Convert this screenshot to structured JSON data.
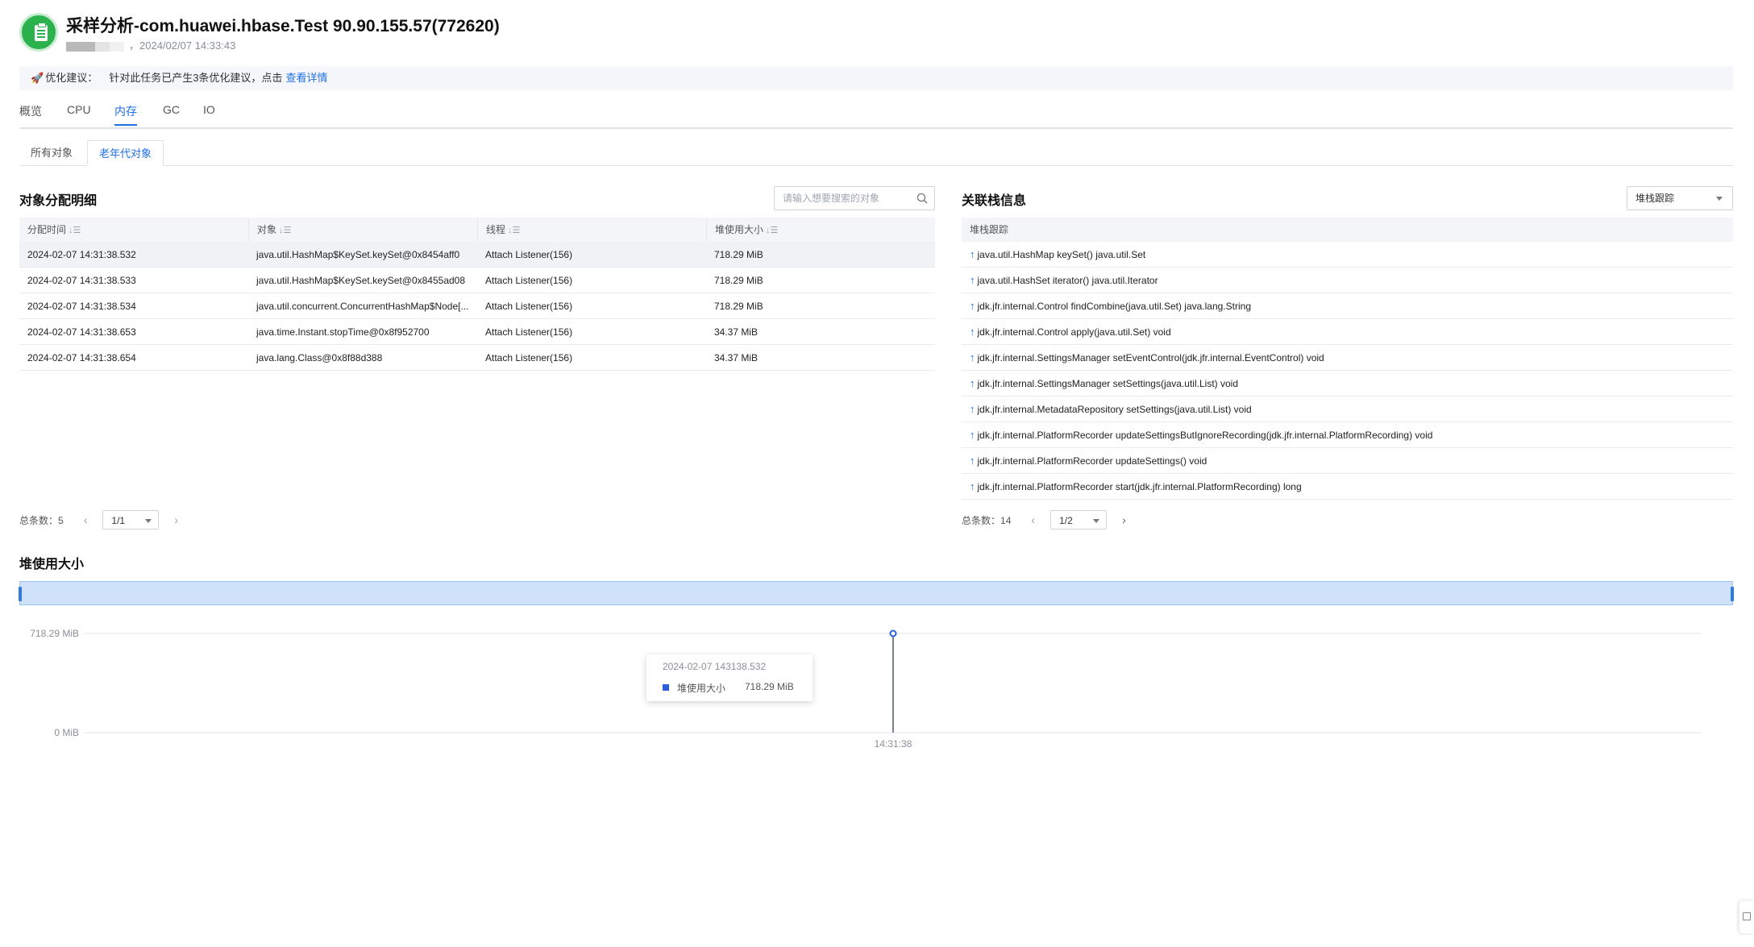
{
  "header": {
    "title": "采样分析-com.huawei.hbase.Test 90.90.155.57(772620)",
    "subtitle_sep": "，",
    "timestamp": "2024/02/07 14:33:43"
  },
  "banner": {
    "label": "优化建议：",
    "text": "针对此任务已产生3条优化建议，点击",
    "link": "查看详情"
  },
  "main_tabs": [
    {
      "label": "概览"
    },
    {
      "label": "CPU"
    },
    {
      "label": "内存",
      "active": true
    },
    {
      "label": "GC"
    },
    {
      "label": "IO"
    }
  ],
  "sub_tabs": [
    {
      "label": "所有对象"
    },
    {
      "label": "老年代对象",
      "active": true
    }
  ],
  "allocation": {
    "title": "对象分配明细",
    "search_placeholder": "请输入想要搜索的对象",
    "columns": [
      "分配时间",
      "对象",
      "线程",
      "堆使用大小"
    ],
    "rows": [
      {
        "time": "2024-02-07 14:31:38.532",
        "object": "java.util.HashMap$KeySet.keySet@0x8454aff0",
        "thread": "Attach Listener(156)",
        "heap": "718.29 MiB"
      },
      {
        "time": "2024-02-07 14:31:38.533",
        "object": "java.util.HashMap$KeySet.keySet@0x8455ad08",
        "thread": "Attach Listener(156)",
        "heap": "718.29 MiB"
      },
      {
        "time": "2024-02-07 14:31:38.534",
        "object": "java.util.concurrent.ConcurrentHashMap$Node[...",
        "thread": "Attach Listener(156)",
        "heap": "718.29 MiB"
      },
      {
        "time": "2024-02-07 14:31:38.653",
        "object": "java.time.Instant.stopTime@0x8f952700",
        "thread": "Attach Listener(156)",
        "heap": "34.37 MiB"
      },
      {
        "time": "2024-02-07 14:31:38.654",
        "object": "java.lang.Class@0x8f88d388",
        "thread": "Attach Listener(156)",
        "heap": "34.37 MiB"
      }
    ],
    "total_label": "总条数：",
    "total": "5",
    "page": "1/1"
  },
  "stack": {
    "title": "关联栈信息",
    "dropdown_value": "堆栈跟踪",
    "column": "堆栈跟踪",
    "rows": [
      "java.util.HashMap keySet() java.util.Set",
      "java.util.HashSet iterator() java.util.Iterator",
      "jdk.jfr.internal.Control findCombine(java.util.Set) java.lang.String",
      "jdk.jfr.internal.Control apply(java.util.Set) void",
      "jdk.jfr.internal.SettingsManager setEventControl(jdk.jfr.internal.EventControl) void",
      "jdk.jfr.internal.SettingsManager setSettings(java.util.List) void",
      "jdk.jfr.internal.MetadataRepository setSettings(java.util.List) void",
      "jdk.jfr.internal.PlatformRecorder updateSettingsButIgnoreRecording(jdk.jfr.internal.PlatformRecording) void",
      "jdk.jfr.internal.PlatformRecorder updateSettings() void",
      "jdk.jfr.internal.PlatformRecorder start(jdk.jfr.internal.PlatformRecording) long"
    ],
    "total_label": "总条数：",
    "total": "14",
    "page": "1/2"
  },
  "heap_chart": {
    "title": "堆使用大小",
    "tooltip_date": "2024-02-07 143138.532",
    "tooltip_series": "堆使用大小",
    "tooltip_value": "718.29 MiB"
  },
  "chart_data": {
    "type": "line",
    "title": "堆使用大小",
    "y_tick_labels": [
      "718.29 MiB",
      "0 MiB"
    ],
    "x_tick_labels": [
      "14:31:38"
    ],
    "ylim": [
      0,
      718.29
    ],
    "x": [
      "14:31:38",
      "14:31:38"
    ],
    "series": [
      {
        "name": "堆使用大小",
        "values": [
          0,
          718.29
        ]
      }
    ],
    "grid": true,
    "legend": "none",
    "colors": {
      "line": "#4a5468",
      "point": "#2b5fd9"
    }
  },
  "colors": {
    "accent": "#1f6fe5",
    "success": "#2bb24c",
    "range_fill": "#cfe2fa"
  }
}
